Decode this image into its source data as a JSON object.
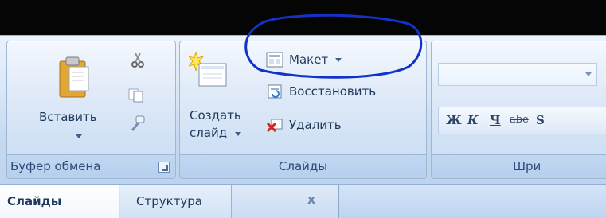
{
  "ribbon": {
    "groups": {
      "clipboard": {
        "label": "Буфер обмена",
        "paste_label": "Вставить"
      },
      "slides": {
        "label": "Слайды",
        "new_slide_line1": "Создать",
        "new_slide_line2": "слайд",
        "layout_label": "Макет",
        "reset_label": "Восстановить",
        "delete_label": "Удалить"
      },
      "font": {
        "label": "Шри",
        "bold": "Ж",
        "italic": "К",
        "underline": "Ч",
        "strikethrough": "abe",
        "shadow": "S"
      }
    }
  },
  "pane_tabs": {
    "slides": "Слайды",
    "outline": "Структура",
    "close": "x"
  },
  "annotation": {
    "color": "#1133c8"
  },
  "icons": [
    "paste-icon",
    "cut-icon",
    "copy-icon",
    "format-painter-icon",
    "new-slide-icon",
    "layout-icon",
    "reset-icon",
    "delete-icon",
    "dialog-launcher-icon",
    "close-icon"
  ]
}
